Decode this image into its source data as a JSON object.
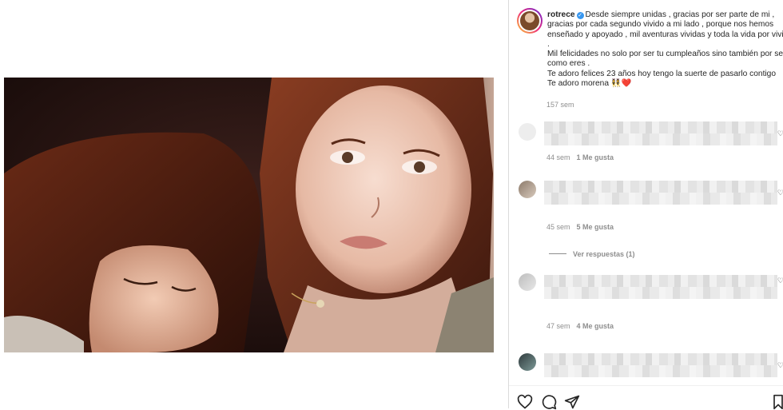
{
  "post": {
    "username": "rotrece",
    "caption": "Desde siempre unidas , gracias por ser parte de mi , gracias por cada segundo vivido a mi lado , porque nos hemos enseñado y apoyado , mil aventuras vividas y toda la vida por vivir .\nMil felicidades no solo por ser tu cumpleaños sino también por ser como eres .\nTe adoro felices 23 años hoy tengo la suerte de pasarlo contigo\nTe adoro morena 👯‍♀️❤️",
    "age": "157 sem"
  },
  "comments": [
    {
      "age": "44 sem",
      "likes": "1 Me gusta"
    },
    {
      "age": "45 sem",
      "likes": "5 Me gusta"
    },
    {
      "age": "47 sem",
      "likes": "4 Me gusta"
    },
    {
      "age": "",
      "likes": ""
    }
  ],
  "replies_label": "Ver respuestas (1)",
  "icons": {
    "verified": "verified-badge-icon",
    "like": "heart-icon",
    "comment": "comment-bubble-icon",
    "share": "paper-plane-icon",
    "save": "bookmark-icon"
  },
  "colors": {
    "text": "#262626",
    "muted": "#8e8e8e",
    "verified": "#3897f0",
    "heart_emoji": "#ed4956"
  }
}
